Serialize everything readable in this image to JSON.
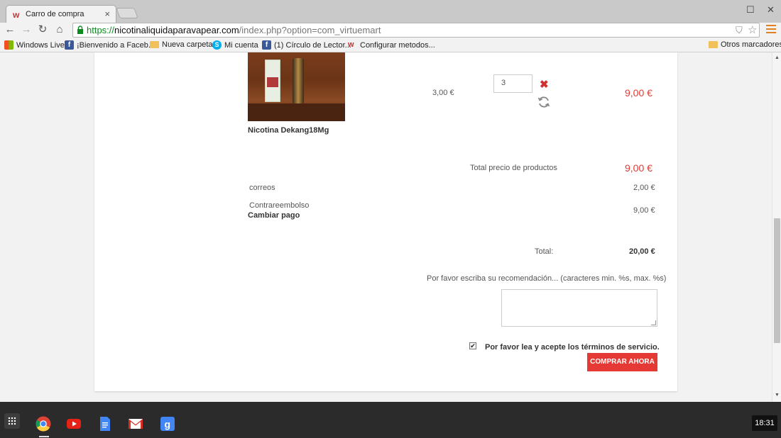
{
  "browser": {
    "tab_title": "Carro de compra",
    "url_scheme": "https://",
    "url_host": "nicotinaliquidaparavapear.com",
    "url_path": "/index.php?option=com_virtuemart",
    "bookmarks": [
      {
        "label": "Windows Live",
        "icon": "windows-icon"
      },
      {
        "label": "¡Bienvenido a Faceb...",
        "icon": "facebook-icon"
      },
      {
        "label": "Nueva carpeta",
        "icon": "folder-icon"
      },
      {
        "label": "Mi cuenta",
        "icon": "skype-icon"
      },
      {
        "label": "(1) Círculo de Lector...",
        "icon": "facebook-icon"
      },
      {
        "label": "Configurar metodos...",
        "icon": "w-site-icon"
      }
    ],
    "other_bookmarks": "Otros marcadores",
    "accent_color": "#e2801f"
  },
  "cart": {
    "product_name": "Nicotina Dekang18Mg",
    "unit_price": "3,00 €",
    "quantity": "3",
    "line_total": "9,00 €",
    "products_total_label": "Total precio de productos",
    "products_total": "9,00 €",
    "shipping_method": "correos",
    "shipping_price": "2,00 €",
    "payment_method": "Contrareembolso",
    "payment_price": "9,00 €",
    "change_payment": "Cambiar pago",
    "total_label": "Total:",
    "total": "20,00 €",
    "comment_label": "Por favor escriba su recomendación... (caracteres min. %s, max. %s)",
    "terms_label": "Por favor lea y acepte los términos de servicio.",
    "terms_checked": true,
    "buy_button": "COMPRAR AHORA",
    "accent_color": "#e53935"
  },
  "taskbar": {
    "clock": "18:31",
    "apps": [
      "chrome-icon",
      "youtube-icon",
      "docs-icon",
      "gmail-icon",
      "google-search-icon"
    ]
  }
}
